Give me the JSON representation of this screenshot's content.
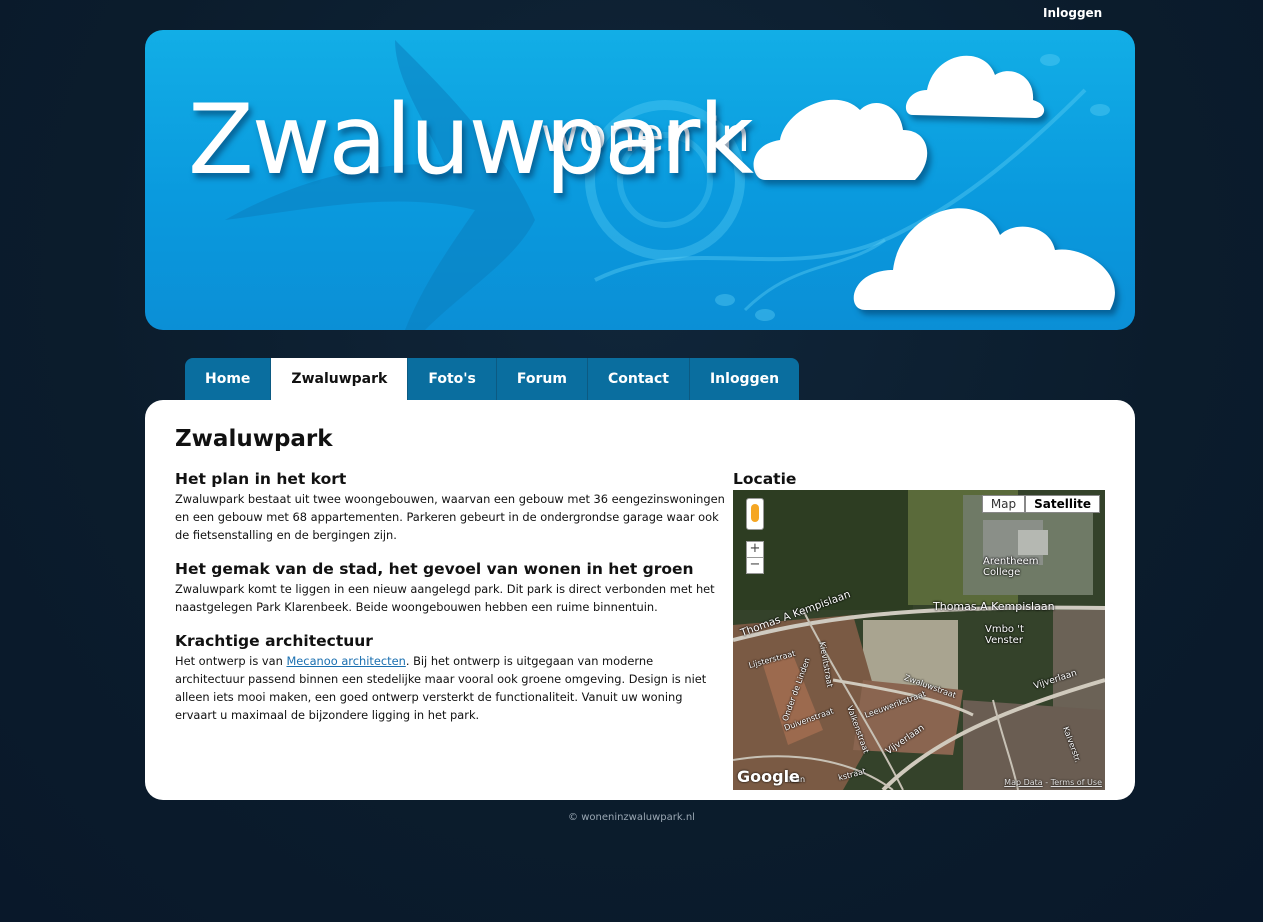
{
  "top": {
    "login_link": "Inloggen"
  },
  "banner": {
    "logo_small": "wonen in",
    "logo_big": "Zwaluwpark"
  },
  "nav": {
    "tabs": [
      {
        "label": "Home"
      },
      {
        "label": "Zwaluwpark"
      },
      {
        "label": "Foto's"
      },
      {
        "label": "Forum"
      },
      {
        "label": "Contact"
      },
      {
        "label": "Inloggen"
      }
    ],
    "active": "Zwaluwpark"
  },
  "content": {
    "title": "Zwaluwpark",
    "sections": [
      {
        "heading": "Het plan in het kort",
        "text": "Zwaluwpark bestaat uit twee woongebouwen, waarvan een gebouw met 36 eengezinswoningen en een gebouw met 68 appartementen. Parkeren gebeurt in de ondergrondse garage waar ook de fietsenstalling en de bergingen zijn."
      },
      {
        "heading": "Het gemak van de stad, het gevoel van wonen in het groen",
        "text": "Zwaluwpark komt te liggen in een nieuw aangelegd park. Dit park is direct verbonden met het naastgelegen Park Klarenbeek. Beide woongebouwen hebben een ruime binnentuin."
      },
      {
        "heading": "Krachtige architectuur",
        "text_before": "Het ontwerp is van ",
        "link": "Mecanoo architecten",
        "text_after": ". Bij het ontwerp is uitgegaan van moderne architectuur passend binnen een stedelijke maar vooral ook groene omgeving. Design is niet alleen iets mooi maken, een goed ontwerp versterkt de functionaliteit. Vanuit uw woning ervaart u maximaal de bijzondere ligging in het park."
      }
    ],
    "locatie_heading": "Locatie"
  },
  "map": {
    "type_buttons": [
      "Map",
      "Satellite"
    ],
    "selected": "Satellite",
    "zoom_in": "+",
    "zoom_out": "−",
    "labels": {
      "college": "Arentheem\nCollege",
      "street1": "Thomas A Kempislaan",
      "street2": "Thomas A Kempislaan",
      "vmbo": "Vmbo 't\nVenster",
      "lijster": "Lijsterstraat",
      "zwaluw": "Zwaluwstraat",
      "vijver1": "Vijverlaan",
      "vijver2": "Vijverlaan",
      "duiven": "Duivenstraat",
      "leeuwerik": "Leeuwerikstraat",
      "valken": "Valkenstraat",
      "kievit": "Kievitstraat",
      "onderde": "Onder de Linden",
      "kalver": "Kalverstr.",
      "krast": "kstraat",
      "laan": "laan"
    },
    "google": "Google",
    "attrib_data": "Map Data",
    "attrib_sep": " - ",
    "attrib_terms": "Terms of Use"
  },
  "footer": {
    "text": "© woneninzwaluwpark.nl"
  },
  "colors": {
    "nav_bg": "#0a6e9f",
    "banner_blue": "#0a9ade",
    "page_bg": "#0b1c2c"
  }
}
